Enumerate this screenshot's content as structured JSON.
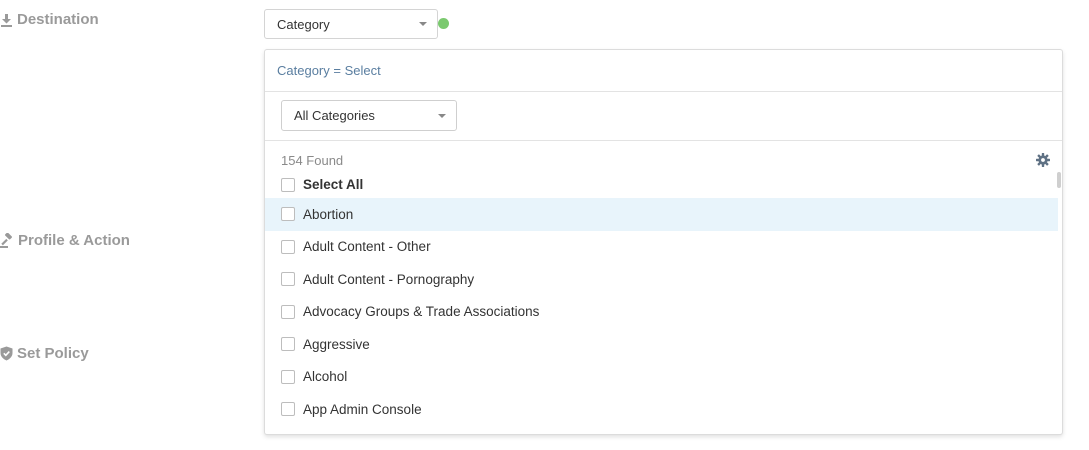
{
  "sections": {
    "destination": "Destination",
    "profile_action": "Profile & Action",
    "set_policy": "Set Policy"
  },
  "destination_type": {
    "selected": "Category"
  },
  "panel": {
    "header": "Category = Select",
    "filter_selected": "All Categories",
    "found_count": "154 Found",
    "select_all_label": "Select All",
    "items": [
      "Abortion",
      "Adult Content - Other",
      "Adult Content - Pornography",
      "Advocacy Groups & Trade Associations",
      "Aggressive",
      "Alcohol",
      "App Admin Console"
    ],
    "hovered_item": "Abortion"
  },
  "icons": {
    "destination": "download-icon",
    "profile_action": "gavel-icon",
    "set_policy": "shield-check-icon",
    "settings": "gear-icon"
  },
  "colors": {
    "status_dot": "#7bc96f",
    "hover_row": "#e8f4fb",
    "header_text": "#5a7ea0"
  }
}
